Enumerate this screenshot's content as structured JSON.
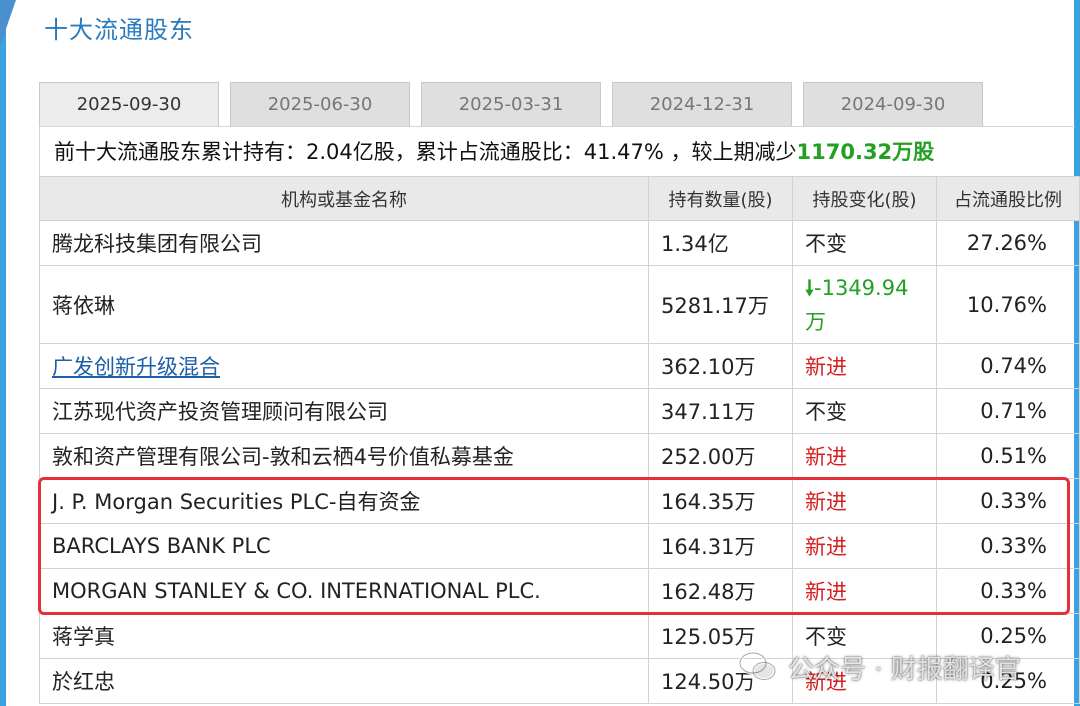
{
  "section": {
    "title": "十大流通股东"
  },
  "tabs": [
    {
      "label": "2025-09-30",
      "active": true
    },
    {
      "label": "2025-06-30",
      "active": false
    },
    {
      "label": "2025-03-31",
      "active": false
    },
    {
      "label": "2024-12-31",
      "active": false
    },
    {
      "label": "2024-09-30",
      "active": false
    }
  ],
  "summary": {
    "text": "前十大流通股东累计持有：2.04亿股，累计占流通股比：41.47% ，较上期减少",
    "change": "1170.32万股"
  },
  "table": {
    "headers": [
      "机构或基金名称",
      "持有数量(股)",
      "持股变化(股)",
      "占流通股比例"
    ],
    "rows": [
      {
        "name": "腾龙科技集团有限公司",
        "qty": "1.34亿",
        "change": "不变",
        "pct": "27.26%"
      },
      {
        "name": "蒋依琳",
        "qty": "5281.17万",
        "change": "-1349.94万",
        "pct": "10.76%"
      },
      {
        "name": "广发创新升级混合",
        "qty": "362.10万",
        "change": "新进",
        "pct": "0.74%"
      },
      {
        "name": "江苏现代资产投资管理顾问有限公司",
        "qty": "347.11万",
        "change": "不变",
        "pct": "0.71%"
      },
      {
        "name": "敦和资产管理有限公司-敦和云栖4号价值私募基金",
        "qty": "252.00万",
        "change": "新进",
        "pct": "0.51%"
      },
      {
        "name": "J. P. Morgan Securities PLC-自有资金",
        "qty": "164.35万",
        "change": "新进",
        "pct": "0.33%"
      },
      {
        "name": "BARCLAYS BANK PLC",
        "qty": "164.31万",
        "change": "新进",
        "pct": "0.33%"
      },
      {
        "name": "MORGAN STANLEY & CO. INTERNATIONAL PLC.",
        "qty": "162.48万",
        "change": "新进",
        "pct": "0.33%"
      },
      {
        "name": "蒋学真",
        "qty": "125.05万",
        "change": "不变",
        "pct": "0.25%"
      },
      {
        "name": "於红忠",
        "qty": "124.50万",
        "change": "新进",
        "pct": "0.25%"
      }
    ]
  },
  "watermark": {
    "text": "公众号 · 财报翻译官"
  },
  "colors": {
    "accent": "#2a7bbd",
    "increase_red": "#d42020",
    "decrease_green": "#22a022",
    "highlight": "#e3303a"
  }
}
